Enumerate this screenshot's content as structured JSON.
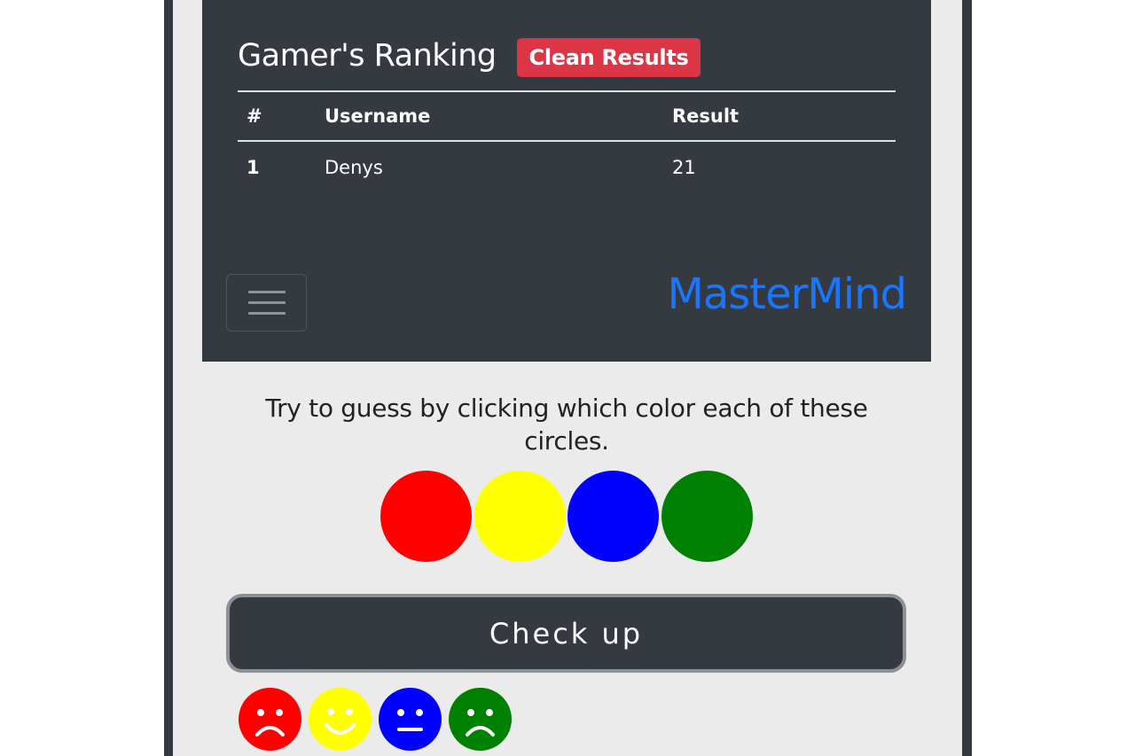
{
  "ranking": {
    "title": "Gamer's Ranking",
    "clean_label": "Clean Results",
    "headers": [
      "#",
      "Username",
      "Result"
    ],
    "rows": [
      {
        "pos": "1",
        "username": "Denys",
        "result": "21"
      }
    ]
  },
  "nav": {
    "brand": "MasterMind",
    "toggler_icon": "hamburger-icon"
  },
  "game": {
    "instructions": "Try to guess by clicking which color each of these circles.",
    "circles": [
      {
        "color": "#ff0000",
        "name": "red"
      },
      {
        "color": "#ffff00",
        "name": "yellow"
      },
      {
        "color": "#0000ff",
        "name": "blue"
      },
      {
        "color": "#008000",
        "name": "green"
      }
    ],
    "check_label": "Check up",
    "feedback": [
      {
        "color": "#ff0000",
        "face": "sad",
        "icon": "sad-face-icon"
      },
      {
        "color": "#ffff00",
        "face": "happy",
        "icon": "happy-face-icon"
      },
      {
        "color": "#0000ff",
        "face": "neutral",
        "icon": "neutral-face-icon"
      },
      {
        "color": "#008000",
        "face": "sad",
        "icon": "sad-face-icon"
      }
    ]
  },
  "colors": {
    "dark": "#343a40",
    "danger": "#dc3545",
    "brand": "#1a76ff",
    "page_bg": "#ebebeb"
  }
}
